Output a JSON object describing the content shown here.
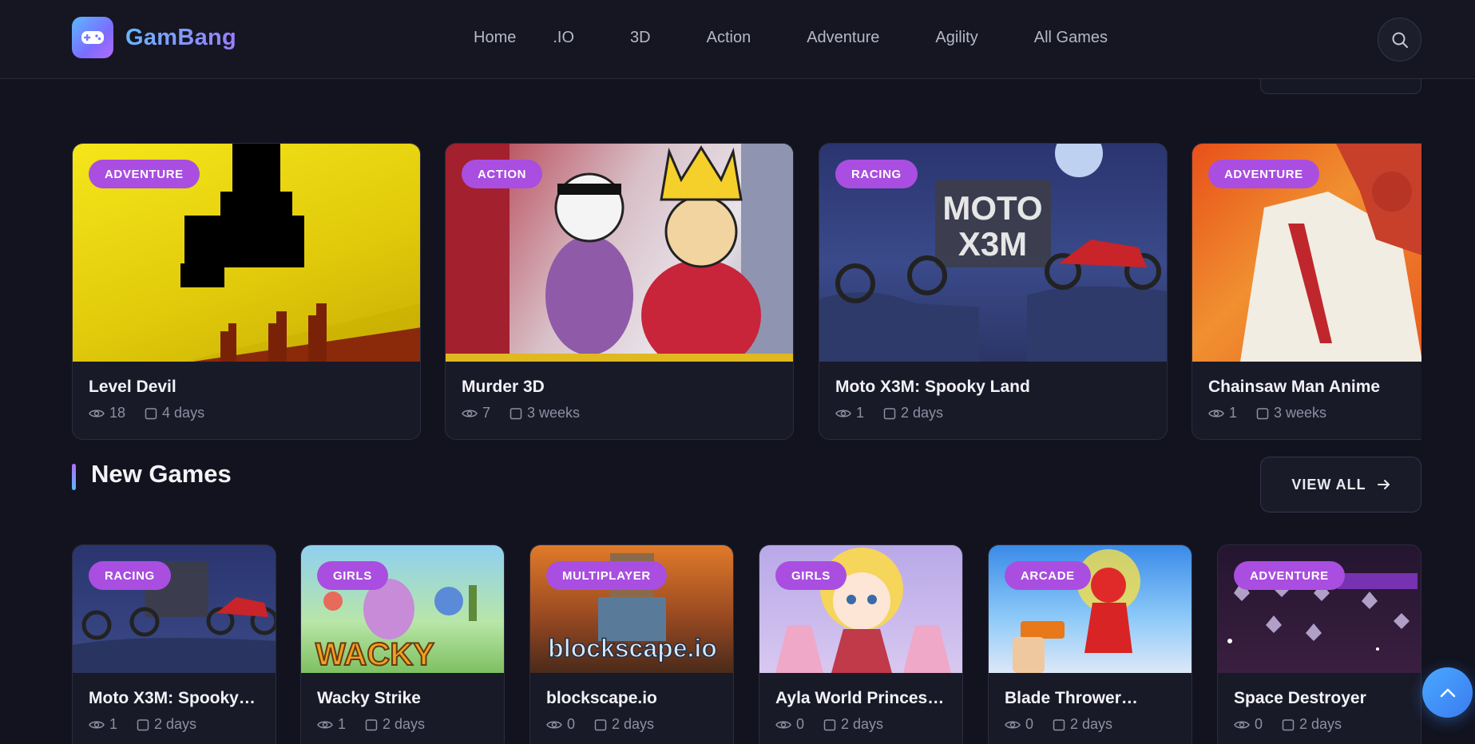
{
  "brand": {
    "name": "GamBang"
  },
  "nav": {
    "items": [
      "Home",
      ".IO",
      "3D",
      "Action",
      "Adventure",
      "Agility",
      "All Games"
    ]
  },
  "icons": {
    "logo": "gamepad-icon",
    "search": "search-icon",
    "views": "eye-icon",
    "date": "calendar-icon",
    "view_all_arrow": "arrow-right-icon",
    "scroll_top": "chevron-up-icon"
  },
  "colors": {
    "background": "#12131f",
    "badge": "#a94ee0",
    "accent_gradient_start": "#5ab8ff",
    "accent_gradient_end": "#b26bff"
  },
  "featured": [
    {
      "category": "ADVENTURE",
      "title": "Level Devil",
      "views": "18",
      "date": "4 days"
    },
    {
      "category": "ACTION",
      "title": "Murder 3D",
      "views": "7",
      "date": "3 weeks"
    },
    {
      "category": "RACING",
      "title": "Moto X3M: Spooky Land",
      "views": "1",
      "date": "2 days"
    },
    {
      "category": "ADVENTURE",
      "title": "Chainsaw Man Anime",
      "views": "1",
      "date": "3 weeks"
    }
  ],
  "new_games": {
    "title": "New Games",
    "view_all_label": "VIEW ALL",
    "items": [
      {
        "category": "RACING",
        "title": "Moto X3M: Spooky…",
        "views": "1",
        "date": "2 days",
        "thumb_text": ""
      },
      {
        "category": "GIRLS",
        "title": "Wacky Strike",
        "views": "1",
        "date": "2 days",
        "thumb_text": "WACKY"
      },
      {
        "category": "MULTIPLAYER",
        "title": "blockscape.io",
        "views": "0",
        "date": "2 days",
        "thumb_text": "blockscape.io"
      },
      {
        "category": "GIRLS",
        "title": "Ayla World Princess…",
        "views": "0",
        "date": "2 days",
        "thumb_text": ""
      },
      {
        "category": "ARCADE",
        "title": "Blade Thrower…",
        "views": "0",
        "date": "2 days",
        "thumb_text": ""
      },
      {
        "category": "ADVENTURE",
        "title": "Space Destroyer",
        "views": "0",
        "date": "2 days",
        "thumb_text": ""
      }
    ]
  }
}
